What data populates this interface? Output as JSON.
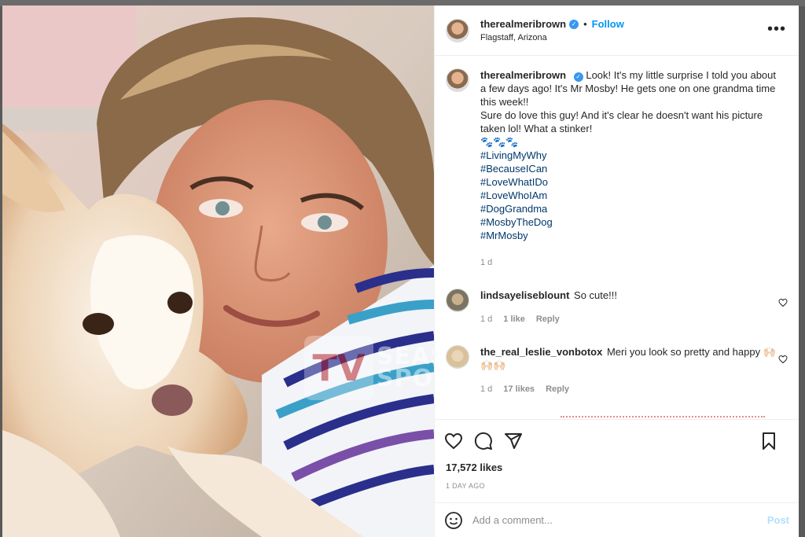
{
  "header": {
    "username": "therealmeribrown",
    "follow_label": "Follow",
    "separator": "•",
    "location": "Flagstaff, Arizona",
    "more_label": "•••"
  },
  "photo": {
    "watermark_logo": "TV",
    "watermark_line1": "SEAS",
    "watermark_line2": "SPOI"
  },
  "caption": {
    "username": "therealmeribrown",
    "lines": [
      "Look! It's my little surprise I told you about a few days ago! It's Mr Mosby! He gets one on one grandma time this week!!",
      "Sure do love this guy! And it's clear he doesn't want his picture taken lol! What a stinker!",
      "🐾🐾🐾"
    ],
    "hashtags": [
      "#LivingMyWhy",
      "#BecauseICan",
      "#LoveWhatIDo",
      "#LoveWhoIAm",
      "#DogGrandma",
      "#MosbyTheDog",
      "#MrMosby"
    ],
    "time": "1 d"
  },
  "comments": [
    {
      "username": "lindsayeliseblount",
      "text": "So cute!!!",
      "time": "1 d",
      "likes": "1 like",
      "reply": "Reply"
    },
    {
      "username": "the_real_leslie_vonbotox",
      "text": "Meri you look so pretty and happy 🙌🏻🙌🏻🙌🏻",
      "time": "1 d",
      "likes": "17 likes",
      "reply": "Reply"
    }
  ],
  "stats": {
    "likes": "17,572 likes",
    "posted": "1 DAY AGO"
  },
  "add_comment": {
    "placeholder": "Add a comment...",
    "post_label": "Post"
  }
}
